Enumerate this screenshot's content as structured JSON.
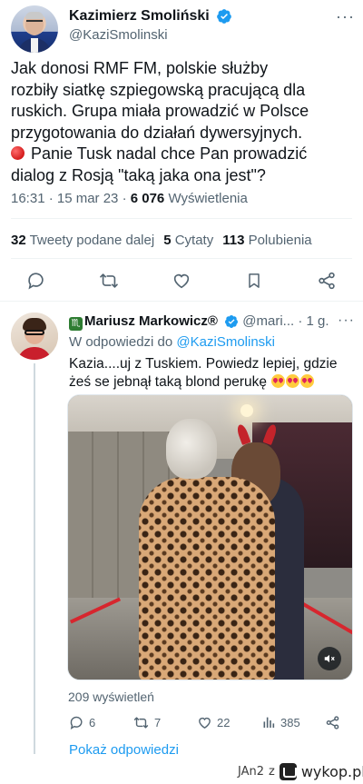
{
  "main_tweet": {
    "author_name": "Kazimierz Smoliński",
    "author_handle": "@KaziSmolinski",
    "text_lines": [
      "Jak donosi RMF FM, polskie służby",
      "rozbiły siatkę szpiegowską pracującą dla",
      "ruskich. Grupa miała prowadzić w Polsce",
      "przygotowania do działań dywersyjnych."
    ],
    "text_line5": "Panie Tusk nadal chce Pan prowadzić",
    "text_line6": "dialog z Rosją \"taką jaka ona jest\"?",
    "time": "16:31 · 15 mar 23 · ",
    "views_count": "6 076",
    "views_label": " Wyświetlenia",
    "retweets_count": "32",
    "retweets_label": " Tweety podane dalej",
    "quotes_count": "5",
    "quotes_label": " Cytaty",
    "likes_count": "113",
    "likes_label": " Polubienia",
    "verified_color": "#1d9bf0"
  },
  "reply": {
    "author_name": "Mariusz Markowicz®",
    "zodiac_glyph": "♏",
    "author_handle": "@mari...",
    "age": " · 1 g.",
    "replying_prefix": "W odpowiedzi do ",
    "replying_handle": "@KaziSmolinski",
    "text_line1": "Kazia....uj z Tuskiem. Powiedz lepiej, gdzie",
    "text_line2": "żeś se jebnął taką blond perukę ",
    "views": "209 wyświetleń",
    "replies": "6",
    "retweets": "7",
    "likes": "22",
    "analytics": "385",
    "show_replies": "Pokaż odpowiedzi"
  },
  "footer": {
    "user": "JAn2",
    "conj": "z",
    "site": "wykop.pl"
  },
  "colors": {
    "link_blue": "#1d9bf0",
    "muted_gray": "#536471",
    "text_dark": "#0f1419"
  }
}
